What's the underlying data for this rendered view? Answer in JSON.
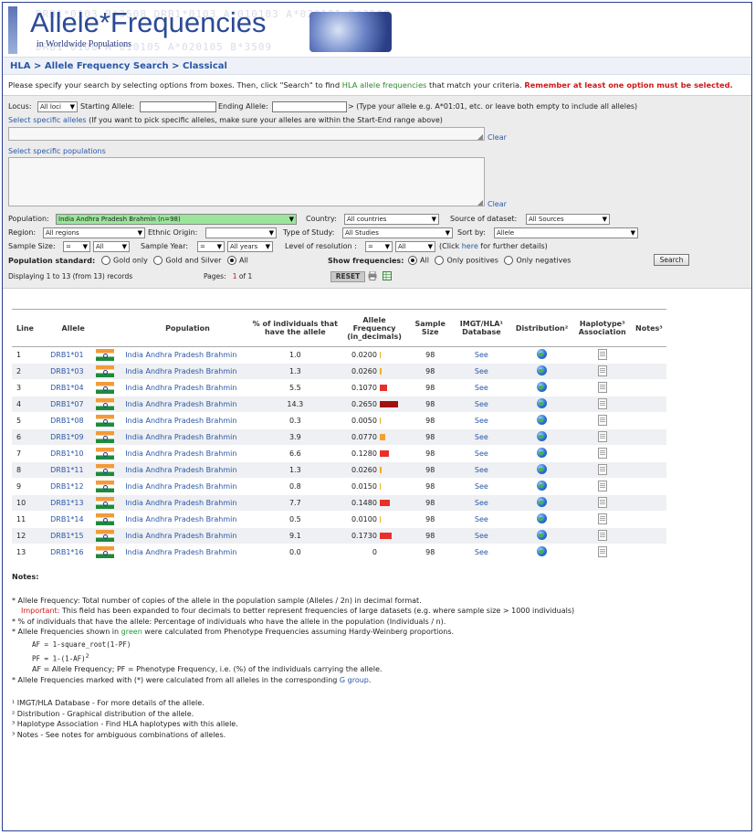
{
  "header": {
    "title": "Allele*Frequencies",
    "subtitle": "in Worldwide Populations"
  },
  "breadcrumb": {
    "items": [
      "HLA",
      "Allele Frequency Search",
      "Classical"
    ],
    "sep": ">"
  },
  "instructions": {
    "text1": "Please specify your search by selecting options from boxes. Then, click \"Search\" to find ",
    "link": "HLA allele frequencies",
    "text2": " that match your criteria. ",
    "warning": "Remember at least one option must be selected."
  },
  "form": {
    "locus_label": "Locus:",
    "locus_value": "All loci",
    "starting_label": "Starting Allele:",
    "ending_label": "Ending Allele:",
    "range_hint": "> (Type your allele e.g. A*01:01, etc. or leave both empty to include all alleles)",
    "select_alleles_link": "Select specific alleles",
    "select_alleles_hint": "(If you want to pick specific alleles, make sure your alleles are within the Start-End range above)",
    "clear1": "Clear",
    "select_pops_link": "Select specific populations",
    "clear2": "Clear",
    "population_label": "Population:",
    "population_value": "India Andhra Pradesh Brahmin (n=98)",
    "country_label": "Country:",
    "country_value": "All countries",
    "source_label": "Source of dataset:",
    "source_value": "All Sources",
    "region_label": "Region:",
    "region_value": "All regions",
    "ethnic_label": "Ethnic Origin:",
    "ethnic_value": "",
    "study_label": "Type of Study:",
    "study_value": "All Studies",
    "sortby_label": "Sort by:",
    "sortby_value": "Allele",
    "samplesize_label": "Sample Size:",
    "samplesize_op": "=",
    "samplesize_value": "All",
    "sampleyear_label": "Sample Year:",
    "sampleyear_op": "=",
    "sampleyear_value": "All years",
    "resolution_label": "Level of resolution :",
    "resolution_op": "=",
    "resolution_value": "All",
    "resolution_hint1": "(Click ",
    "resolution_here": "here",
    "resolution_hint2": " for further details)",
    "popstd_label": "Population standard:",
    "popstd_options": [
      "Gold only",
      "Gold and Silver",
      "All"
    ],
    "popstd_selected": "All",
    "showfreq_label": "Show frequencies:",
    "showfreq_options": [
      "All",
      "Only positives",
      "Only negatives"
    ],
    "showfreq_selected": "All",
    "search_button": "Search",
    "displaying": "Displaying 1 to 13 (from 13) records",
    "pages_label": "Pages:",
    "pages_current": "1",
    "pages_of": "of 1",
    "reset_button": "RESET"
  },
  "table": {
    "headers": {
      "line": "Line",
      "allele": "Allele",
      "population": "Population",
      "pct": "% of individuals that have the allele",
      "freq": "Allele Frequency (in_decimals)",
      "sample": "Sample Size",
      "imgt": "IMGT/HLA¹ Database",
      "dist": "Distribution²",
      "hap": "Haplotype³ Association",
      "notes": "Notes³"
    },
    "rows": [
      {
        "line": "1",
        "allele": "DRB1*01",
        "population": "India Andhra Pradesh Brahmin",
        "pct": "1.0",
        "freq": "0.0200",
        "freq_value": 0.02,
        "sample": "98",
        "imgt": "See"
      },
      {
        "line": "2",
        "allele": "DRB1*03",
        "population": "India Andhra Pradesh Brahmin",
        "pct": "1.3",
        "freq": "0.0260",
        "freq_value": 0.026,
        "sample": "98",
        "imgt": "See"
      },
      {
        "line": "3",
        "allele": "DRB1*04",
        "population": "India Andhra Pradesh Brahmin",
        "pct": "5.5",
        "freq": "0.1070",
        "freq_value": 0.107,
        "sample": "98",
        "imgt": "See"
      },
      {
        "line": "4",
        "allele": "DRB1*07",
        "population": "India Andhra Pradesh Brahmin",
        "pct": "14.3",
        "freq": "0.2650",
        "freq_value": 0.265,
        "sample": "98",
        "imgt": "See"
      },
      {
        "line": "5",
        "allele": "DRB1*08",
        "population": "India Andhra Pradesh Brahmin",
        "pct": "0.3",
        "freq": "0.0050",
        "freq_value": 0.005,
        "sample": "98",
        "imgt": "See"
      },
      {
        "line": "6",
        "allele": "DRB1*09",
        "population": "India Andhra Pradesh Brahmin",
        "pct": "3.9",
        "freq": "0.0770",
        "freq_value": 0.077,
        "sample": "98",
        "imgt": "See"
      },
      {
        "line": "7",
        "allele": "DRB1*10",
        "population": "India Andhra Pradesh Brahmin",
        "pct": "6.6",
        "freq": "0.1280",
        "freq_value": 0.128,
        "sample": "98",
        "imgt": "See"
      },
      {
        "line": "8",
        "allele": "DRB1*11",
        "population": "India Andhra Pradesh Brahmin",
        "pct": "1.3",
        "freq": "0.0260",
        "freq_value": 0.026,
        "sample": "98",
        "imgt": "See"
      },
      {
        "line": "9",
        "allele": "DRB1*12",
        "population": "India Andhra Pradesh Brahmin",
        "pct": "0.8",
        "freq": "0.0150",
        "freq_value": 0.015,
        "sample": "98",
        "imgt": "See"
      },
      {
        "line": "10",
        "allele": "DRB1*13",
        "population": "India Andhra Pradesh Brahmin",
        "pct": "7.7",
        "freq": "0.1480",
        "freq_value": 0.148,
        "sample": "98",
        "imgt": "See"
      },
      {
        "line": "11",
        "allele": "DRB1*14",
        "population": "India Andhra Pradesh Brahmin",
        "pct": "0.5",
        "freq": "0.0100",
        "freq_value": 0.01,
        "sample": "98",
        "imgt": "See"
      },
      {
        "line": "12",
        "allele": "DRB1*15",
        "population": "India Andhra Pradesh Brahmin",
        "pct": "9.1",
        "freq": "0.1730",
        "freq_value": 0.173,
        "sample": "98",
        "imgt": "See"
      },
      {
        "line": "13",
        "allele": "DRB1*16",
        "population": "India Andhra Pradesh Brahmin",
        "pct": "0.0",
        "freq": "0",
        "freq_value": 0,
        "sample": "98",
        "imgt": "See"
      }
    ]
  },
  "notes": {
    "heading": "Notes:",
    "n1": "* Allele Frequency: Total number of copies of the allele in the population sample (Alleles / 2n) in decimal format.",
    "n1_important": "Important:",
    "n1b": " This field has been expanded to four decimals to better represent frequencies of large datasets (e.g. where sample size > 1000 individuals)",
    "n2": "* % of individuals that have the allele: Percentage of individuals who have the allele in the population (Individuals / n).",
    "n3a": "* Allele Frequencies shown in ",
    "n3_green": "green",
    "n3b": " were calculated from Phenotype Frequencies assuming Hardy-Weinberg proportions.",
    "f1": "AF = 1-square_root(1-PF)",
    "f2": "PF = 1-(1-AF)",
    "f2_sup": "2",
    "f3": "AF = Allele Frequency; PF = Phenotype Frequency, i.e. (%) of the individuals carrying the allele.",
    "n4a": "* Allele Frequencies marked with (*) were calculated from all alleles in the corresponding ",
    "n4_link": "G group",
    "n4b": ".",
    "fn1": "¹ IMGT/HLA Database - For more details of the allele.",
    "fn2": "² Distribution - Graphical distribution of the allele.",
    "fn3": "³ Haplotype Association - Find HLA haplotypes with this allele.",
    "fn4": "³ Notes - See notes for ambiguous combinations of alleles."
  },
  "colors": {
    "accent": "#2a57a8",
    "warning": "#d01818",
    "freq_bar_low": "#f0b020",
    "freq_bar_high": "#a01010"
  }
}
